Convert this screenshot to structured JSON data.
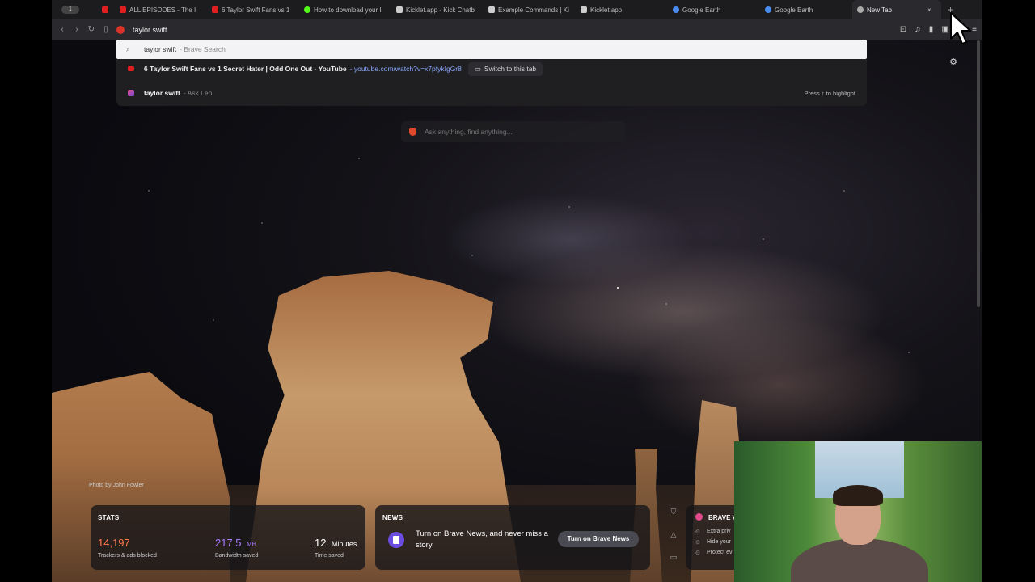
{
  "tabs": {
    "counter": "1",
    "items": [
      {
        "title": "",
        "favicon": "youtube-icon",
        "color": "#e02020"
      },
      {
        "title": "ALL EPISODES - The I",
        "favicon": "youtube-icon",
        "color": "#e02020"
      },
      {
        "title": "6 Taylor Swift Fans vs 1",
        "favicon": "youtube-icon",
        "color": "#e02020"
      },
      {
        "title": "How to download your I",
        "favicon": "kick-icon",
        "color": "#53fc18"
      },
      {
        "title": "Kicklet.app - Kick Chatb",
        "favicon": "kicklet-icon",
        "color": "#cccccc"
      },
      {
        "title": "Example Commands | Ki",
        "favicon": "kicklet-icon",
        "color": "#cccccc"
      },
      {
        "title": "Kicklet.app",
        "favicon": "kicklet-icon",
        "color": "#cccccc"
      },
      {
        "title": "Google Earth",
        "favicon": "earth-icon",
        "color": "#4a8cf0"
      },
      {
        "title": "Google Earth",
        "favicon": "earth-icon",
        "color": "#4a8cf0"
      },
      {
        "title": "New Tab",
        "favicon": "brave-icon",
        "color": "#aaaaaa",
        "active": true
      }
    ],
    "close_symbol": "×",
    "new_tab_symbol": "+"
  },
  "toolbar": {
    "url_value": "taylor swift"
  },
  "dropdown": {
    "row1": {
      "query": "taylor swift",
      "source": "- Brave Search"
    },
    "row2": {
      "title": "6 Taylor Swift Fans vs 1 Secret Hater | Odd One Out - YouTube",
      "url": "- youtube.com/watch?v=x7pfykIgGr8",
      "switch_label": "Switch to this tab"
    },
    "row3": {
      "query": "taylor swift",
      "source": "- Ask Leo",
      "hint": "Press ↑ to highlight"
    }
  },
  "ask": {
    "placeholder": "Ask anything, find anything..."
  },
  "photo_credit": "Photo by John Fowler",
  "stats": {
    "title": "STATS",
    "trackers": {
      "value": "14,197",
      "label": "Trackers & ads blocked"
    },
    "bandwidth": {
      "value": "217.5",
      "unit": "MB",
      "label": "Bandwidth saved"
    },
    "time": {
      "value": "12",
      "unit": "Minutes",
      "label": "Time saved"
    }
  },
  "news": {
    "title": "NEWS",
    "text": "Turn on Brave News, and never miss a story",
    "button": "Turn on Brave News"
  },
  "vpn": {
    "title": "BRAVE V",
    "lines": [
      "Extra priv",
      "Hide your",
      "Protect ev"
    ]
  },
  "colors": {
    "accent_orange": "#ff7a4d",
    "accent_purple": "#a77bff",
    "brave_red": "#e2472c"
  }
}
